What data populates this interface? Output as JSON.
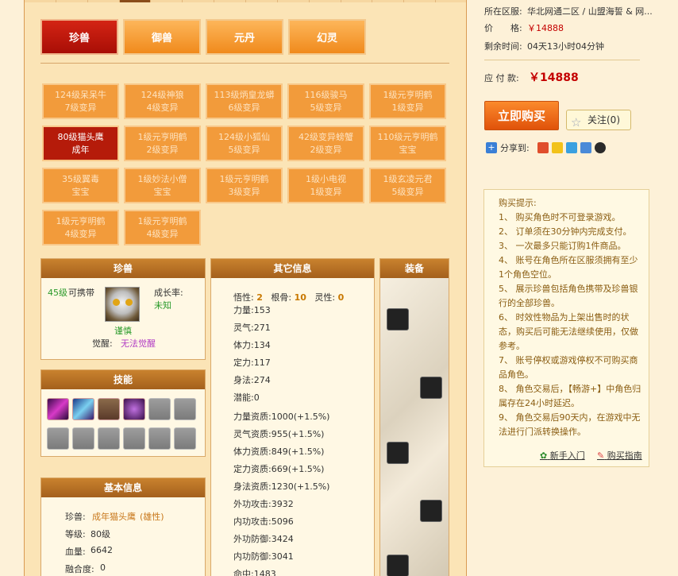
{
  "categories": [
    "珍兽",
    "御兽",
    "元丹",
    "幻灵"
  ],
  "pets": [
    {
      "line1": "124级呆呆牛",
      "line2": "7级变异"
    },
    {
      "line1": "124级神狼",
      "line2": "4级变异"
    },
    {
      "line1": "113级炳皇龙蟒",
      "line2": "6级变异"
    },
    {
      "line1": "116级骏马",
      "line2": "5级变异"
    },
    {
      "line1": "1级元亨明鹤",
      "line2": "1级变异"
    },
    {
      "line1": "80级猫头鹰",
      "line2": "成年"
    },
    {
      "line1": "1级元亨明鹤",
      "line2": "2级变异"
    },
    {
      "line1": "124级小狐仙",
      "line2": "5级变异"
    },
    {
      "line1": "42级变异螃蟹",
      "line2": "2级变异"
    },
    {
      "line1": "110级元亨明鹤",
      "line2": "宝宝"
    },
    {
      "line1": "35级翼毒",
      "line2": "宝宝"
    },
    {
      "line1": "1级妙法小僧",
      "line2": "宝宝"
    },
    {
      "line1": "1级元亨明鹤",
      "line2": "3级变异"
    },
    {
      "line1": "1级小电视",
      "line2": "1级变异"
    },
    {
      "line1": "1级玄凌元君",
      "line2": "5级变异"
    },
    {
      "line1": "1级元亨明鹤",
      "line2": "4级变异"
    },
    {
      "line1": "1级元亨明鹤",
      "line2": "4级变异"
    }
  ],
  "pet_panel": {
    "title": "珍兽",
    "level": "45级",
    "carry": "可携带",
    "growth_label": "成长率:",
    "growth_value": "未知",
    "temper": "谨慎",
    "awaken_label": "觉醒:",
    "awaken_value": "无法觉醒"
  },
  "skills_panel": {
    "title": "技能"
  },
  "basic_panel": {
    "title": "基本信息",
    "pet_label": "珍兽:",
    "pet_name": "成年猫头鹰",
    "gender": "(雄性)",
    "level_label": "等级:",
    "level_value": "80级",
    "hp_label": "血量:",
    "hp_value": "6642",
    "fusion_label": "融合度:",
    "fusion_value": "0"
  },
  "other_panel": {
    "title": "其它信息",
    "wuxing_label": "悟性:",
    "wuxing": "2",
    "genxing_label": "根骨:",
    "genxing": "10",
    "lingxing_label": "灵性:",
    "lingxing": "0",
    "rows": [
      {
        "label": "力量:",
        "value": "153"
      },
      {
        "label": "灵气:",
        "value": "271"
      },
      {
        "label": "体力:",
        "value": "134"
      },
      {
        "label": "定力:",
        "value": "117"
      },
      {
        "label": "身法:",
        "value": "274"
      },
      {
        "label": "潜能:",
        "value": "0"
      },
      {
        "label": "力量资质:",
        "value": "1000(+1.5%)"
      },
      {
        "label": "灵气资质:",
        "value": "955(+1.5%)"
      },
      {
        "label": "体力资质:",
        "value": "849(+1.5%)"
      },
      {
        "label": "定力资质:",
        "value": "669(+1.5%)"
      },
      {
        "label": "身法资质:",
        "value": "1230(+1.5%)"
      },
      {
        "label": "外功攻击:",
        "value": "3932"
      },
      {
        "label": "内功攻击:",
        "value": "5096"
      },
      {
        "label": "外功防御:",
        "value": "3424"
      },
      {
        "label": "内功防御:",
        "value": "3041"
      },
      {
        "label": "命中:",
        "value": "1483"
      }
    ]
  },
  "equip_panel": {
    "title": "装备"
  },
  "right": {
    "server_label": "所在区服:",
    "server_value": "华北网通二区 / 山盟海誓 & 网...",
    "price_label": "价　　格:",
    "price_value": "￥14888",
    "remain_label": "剩余时间:",
    "remain_value": "04天13小时04分钟",
    "pay_label": "应 付 款:",
    "pay_value": "￥14888",
    "buy_label": "立即购买",
    "follow_label": "关注(0)",
    "share_label": "分享到:"
  },
  "tips": {
    "title": "购买提示:",
    "items": [
      "1、 购买角色时不可登录游戏。",
      "2、 订单须在30分钟内完成支付。",
      "3、 一次最多只能订购1件商品。",
      "4、 账号在角色所在区服须拥有至少1个角色空位。",
      "5、 展示珍兽包括角色携带及珍兽银行的全部珍兽。",
      "6、 时效性物品为上架出售时的状态，购买后可能无法继续使用，仅做参考。",
      "7、 账号停权或游戏停权不可购买商品角色。",
      "8、 角色交易后，【畅游+】中角色归属存在24小时延迟。",
      "9、 角色交易后90天内，在游戏中无法进行门派转换操作。"
    ],
    "newbie": "新手入门",
    "guide": "购买指南"
  }
}
